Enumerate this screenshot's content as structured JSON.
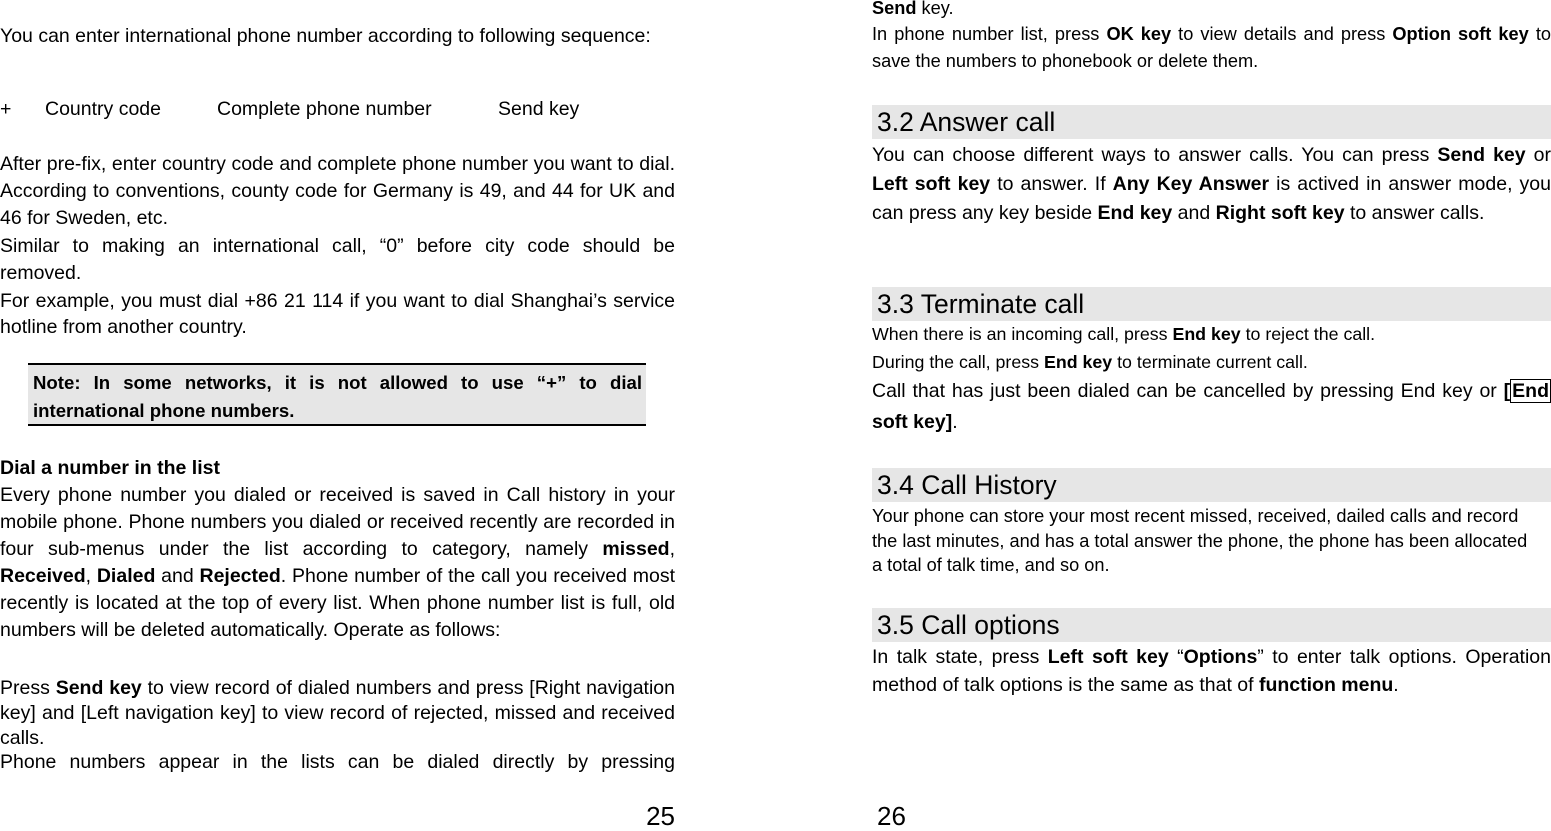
{
  "left_page": {
    "intro": "You can enter international phone number according to following sequence:",
    "sequence": [
      "+",
      "Country code",
      "Complete phone number",
      "Send key"
    ],
    "para1": "After pre-fix, enter country code and complete phone number you want to dial. According to conventions, county code for Germany is 49, and 44 for UK and 46 for Sweden, etc.",
    "para2": "Similar to making an international call, “0” before city code should be removed.",
    "para3": "For example, you must dial +86 21 114 if you want to dial Shanghai’s service hotline from another country.",
    "note": "Note: In some networks, it is not allowed to use “+” to dial international phone numbers.",
    "heading": "Dial a number in the list",
    "list_para": {
      "t1": "Every phone number you dialed or received is saved in Call history in your mobile phone. Phone numbers you dialed or received recently are recorded in four sub-menus under the list according to category, namely ",
      "b1": "missed",
      "t2": ", ",
      "b2": "Received",
      "t3": ", ",
      "b3": "Dialed",
      "t4": " and ",
      "b4": "Rejected",
      "t5": ". Phone number of the call you received most recently is located at the top of every list. When phone number list is full, old numbers will be deleted automatically. Operate as follows:"
    },
    "press_para": {
      "t1": "Press ",
      "b1": "Send key",
      "t2": " to view record of dialed numbers and press [Right navigation key] and [Left navigation key] to view record of rejected, missed and received calls."
    },
    "last_para": "Phone numbers appear in the lists can be dialed directly by pressing",
    "page_number": "25"
  },
  "right_page": {
    "cont": {
      "b1": "Send",
      "t1": " key."
    },
    "list_para": {
      "t1": "In phone number list, press ",
      "b1": "OK key",
      "t2": " to view details and press ",
      "b2": "Option soft key",
      "t3": " to save the numbers to phonebook or delete them."
    },
    "sections": [
      {
        "title": "3.2 Answer call",
        "body": {
          "t1": "You can choose different ways to answer calls. You can press ",
          "b1": "Send key",
          "t2": " or ",
          "b2": "Left soft key",
          "t3": " to answer. If ",
          "b3": "Any Key Answer",
          "t4": " is actived in answer mode, you can press any key beside ",
          "b4": "End key",
          "t5": " and ",
          "b5": "Right soft key",
          "t6": " to answer calls."
        }
      },
      {
        "title": "3.3 Terminate call",
        "line1": {
          "t1": "When there is an incoming call, press ",
          "b1": "End key",
          "t2": " to reject the call."
        },
        "line2": {
          "t1": "During the call, press ",
          "b1": "End key",
          "t2": " to terminate current call."
        },
        "line3": {
          "t1": "Call that has just been dialed can be cancelled by pressing End key or ",
          "b1": "[",
          "b2": "End",
          "b3": " soft key]",
          "t2": "."
        }
      },
      {
        "title": "3.4 Call History",
        "body": "Your phone can store your most recent missed, received, dailed calls and record the last minutes, and has a total answer the phone, the phone has been allocated a total of talk time, and so on."
      },
      {
        "title": "3.5 Call options",
        "body": {
          "t1": "In talk state, press ",
          "b1": "Left soft key",
          "t2": " “",
          "b2": "Options",
          "t3": "” to enter talk options. Operation method of talk options is the same as that of ",
          "b3": "function menu",
          "t4": "."
        }
      }
    ],
    "page_number": "26"
  }
}
